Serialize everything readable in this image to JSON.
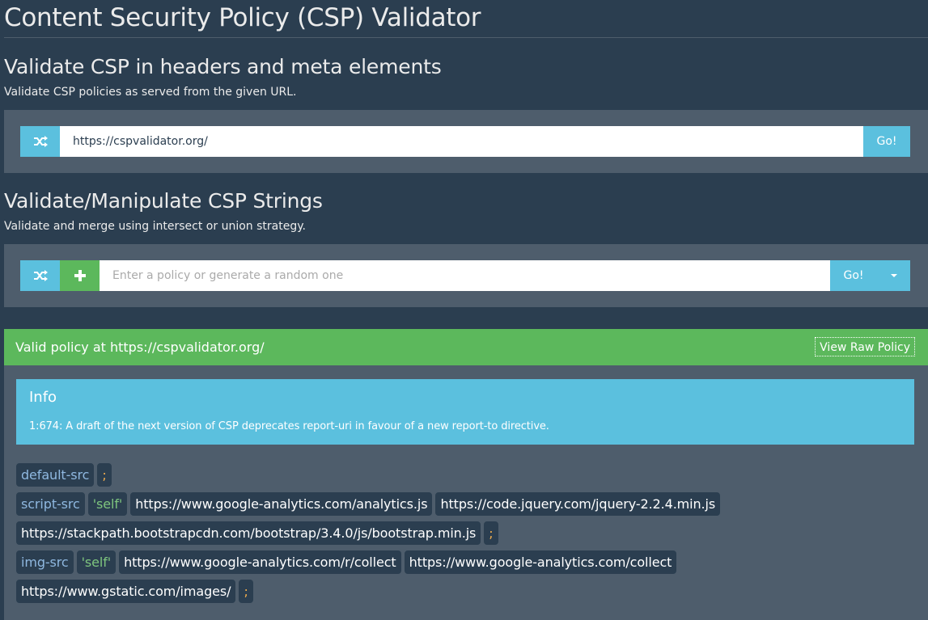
{
  "header": {
    "title": "Content Security Policy (CSP) Validator"
  },
  "section_url": {
    "title": "Validate CSP in headers and meta elements",
    "description": "Validate CSP policies as served from the given URL.",
    "input_value": "https://cspvalidator.org/",
    "go_label": "Go!"
  },
  "section_string": {
    "title": "Validate/Manipulate CSP Strings",
    "description": "Validate and merge using intersect or union strategy.",
    "input_placeholder": "Enter a policy or generate a random one",
    "go_label": "Go!"
  },
  "result": {
    "title": "Valid policy at https://cspvalidator.org/",
    "raw_label": "View Raw Policy",
    "info_title": "Info",
    "info_message": "1:674: A draft of the next version of CSP deprecates report-uri in favour of a new report-to directive."
  },
  "directives": [
    [
      {
        "type": "dir",
        "text": "default-src"
      },
      {
        "type": "semi",
        "text": ";"
      }
    ],
    [
      {
        "type": "dir",
        "text": "script-src"
      },
      {
        "type": "kw",
        "text": "'self'"
      },
      {
        "type": "src",
        "text": "https://www.google-analytics.com/analytics.js"
      },
      {
        "type": "src",
        "text": "https://code.jquery.com/jquery-2.2.4.min.js"
      }
    ],
    [
      {
        "type": "src",
        "text": "https://stackpath.bootstrapcdn.com/bootstrap/3.4.0/js/bootstrap.min.js"
      },
      {
        "type": "semi",
        "text": ";"
      }
    ],
    [
      {
        "type": "dir",
        "text": "img-src"
      },
      {
        "type": "kw",
        "text": "'self'"
      },
      {
        "type": "src",
        "text": "https://www.google-analytics.com/r/collect"
      },
      {
        "type": "src",
        "text": "https://www.google-analytics.com/collect"
      }
    ],
    [
      {
        "type": "src",
        "text": "https://www.gstatic.com/images/"
      },
      {
        "type": "semi",
        "text": ";"
      }
    ]
  ],
  "icons": {
    "shuffle": "shuffle-icon",
    "plus": "plus-icon",
    "caret": "chevron-down-icon"
  }
}
